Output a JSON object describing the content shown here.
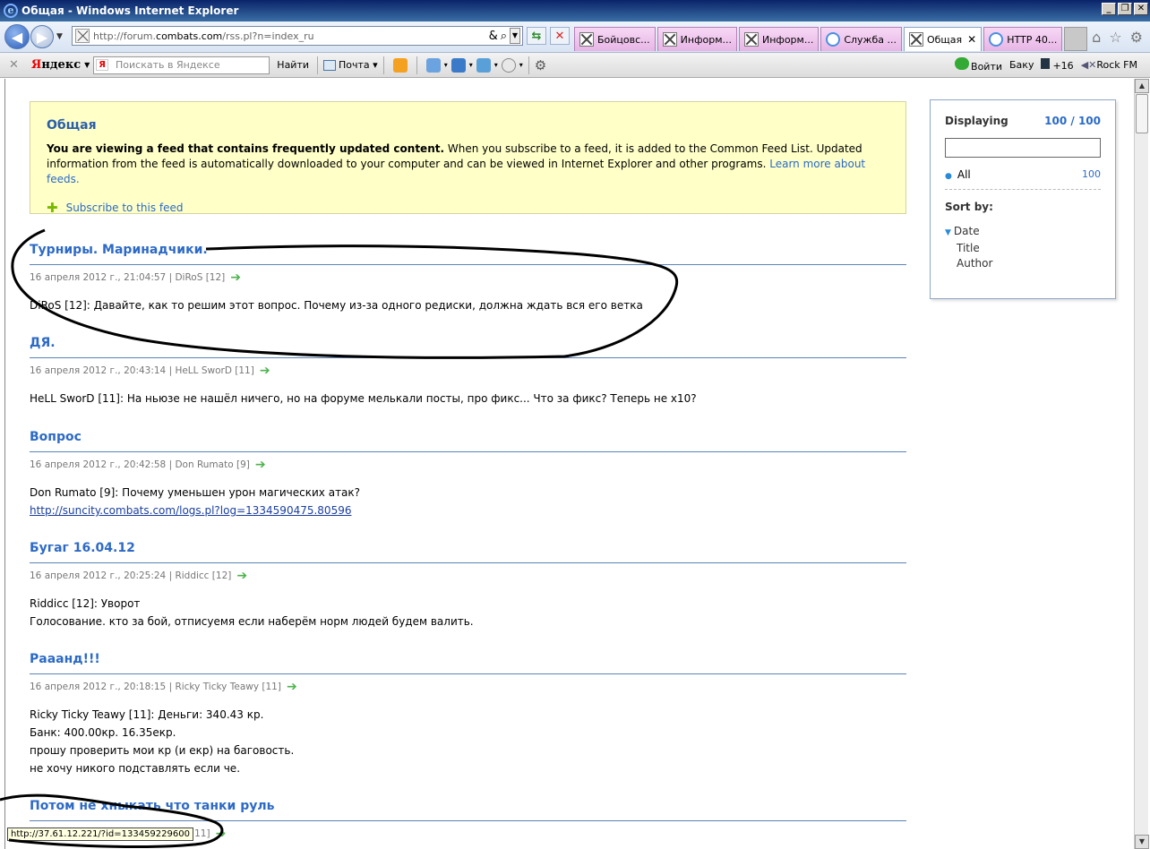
{
  "window": {
    "title": "Общая - Windows Internet Explorer"
  },
  "address": {
    "url_prefix": "http://forum.",
    "url_domain": "combats.com",
    "url_suffix": "/rss.pl?n=index_ru"
  },
  "tabs": [
    {
      "label": "Бойцовс...",
      "icon": "crossed-swords-icon",
      "active": false
    },
    {
      "label": "Информ...",
      "icon": "crossed-swords-icon",
      "active": false
    },
    {
      "label": "Информ...",
      "icon": "crossed-swords-icon",
      "active": false
    },
    {
      "label": "Служба ...",
      "icon": "ie-icon",
      "active": false
    },
    {
      "label": "Общая",
      "icon": "crossed-swords-icon",
      "active": true
    },
    {
      "label": "HTTP 40...",
      "icon": "ie-icon",
      "active": false
    }
  ],
  "yandex": {
    "logo_first": "Я",
    "logo_rest": "ндекс",
    "search_badge": "Я",
    "search_placeholder": "Поискать в Яндексе",
    "find_label": "Найти",
    "mail_label": "Почта",
    "login_label": "Войти",
    "city_label": "Баку",
    "temp_label": "+16",
    "radio_label": "Rock FM"
  },
  "feed": {
    "title": "Общая",
    "desc_bold": "You are viewing a feed that contains frequently updated content.",
    "desc_rest": " When you subscribe to a feed, it is added to the Common Feed List. Updated information from the feed is automatically downloaded to your computer and can be viewed in Internet Explorer and other programs. ",
    "learn_more": "Learn more about feeds.",
    "subscribe": "Subscribe to this feed"
  },
  "items": [
    {
      "title": "Турниры. Маринадчики.",
      "meta": "16 апреля 2012 г., 21:04:57 | DiRoS [12]",
      "lines": [
        "DiRoS [12]: Давайте, как то решим этот вопрос. Почему из-за одного редиски, должна ждать вся его ветка"
      ]
    },
    {
      "title": "ДЯ.",
      "meta": "16 апреля 2012 г., 20:43:14 | HeLL SworD [11]",
      "lines": [
        "HeLL SworD [11]: На ньюзе не нашёл ничего, но на форуме мелькали посты, про фикс... Что за фикс? Теперь не х10?"
      ]
    },
    {
      "title": "Вопрос",
      "meta": "16 апреля 2012 г., 20:42:58 | Don Rumato [9]",
      "lines": [
        "Don Rumato [9]: Почему уменьшен урон магических атак?"
      ],
      "link": "http://suncity.combats.com/logs.pl?log=1334590475.80596"
    },
    {
      "title": "Бугаг 16.04.12",
      "meta": "16 апреля 2012 г., 20:25:24 | Riddicc [12]",
      "lines": [
        "Riddicc [12]: Уворот",
        "Голосование. кто за бой, отписуемя если наберём норм людей будем валить."
      ]
    },
    {
      "title": "Рааанд!!!",
      "meta": "16 апреля 2012 г., 20:18:15 | Ricky Ticky Teawy [11]",
      "lines": [
        "Ricky Ticky Teawy [11]: Деньги: 340.43 кр.",
        "Банк: 400.00кр. 16.35екр.",
        "прошу проверить мои кр (и екр) на баговость.",
        "не хочу никого подставлять если че."
      ]
    },
    {
      "title": "Потом не хныкать что танки руль",
      "meta": "[11]",
      "lines": []
    }
  ],
  "sidebar": {
    "displaying_label": "Displaying",
    "displaying_count": "100 / 100",
    "all_label": "All",
    "all_count": "100",
    "sortby_label": "Sort by:",
    "sort_date": "Date",
    "sort_title": "Title",
    "sort_author": "Author"
  },
  "status": {
    "text": "http://37.61.12.221/?id=133459229600"
  }
}
